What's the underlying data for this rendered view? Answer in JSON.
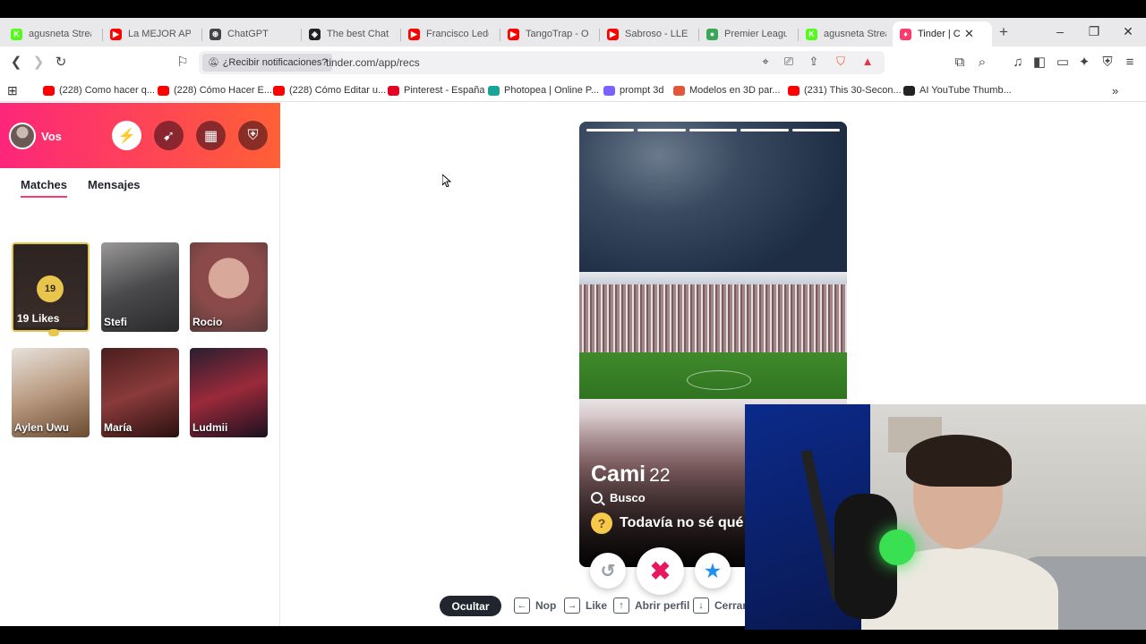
{
  "tabs": [
    {
      "title": "agusneta Stream",
      "color": "#53fc18",
      "glyph": "K"
    },
    {
      "title": "La MEJOR APER",
      "color": "#ff0000",
      "glyph": "▶"
    },
    {
      "title": "ChatGPT",
      "color": "#444444",
      "glyph": "⊛"
    },
    {
      "title": "The best ChatB",
      "color": "#222222",
      "glyph": "◈"
    },
    {
      "title": "Francisco Lede",
      "color": "#ff0000",
      "glyph": "▶"
    },
    {
      "title": "TangoTrap - Os",
      "color": "#ff0000",
      "glyph": "▶"
    },
    {
      "title": "Sabroso - LLEG",
      "color": "#ff0000",
      "glyph": "▶"
    },
    {
      "title": "Premier League",
      "color": "#3aa757",
      "glyph": "●"
    },
    {
      "title": "agusneta Strea",
      "color": "#53fc18",
      "glyph": "K"
    },
    {
      "title": "Tinder | Co",
      "color": "#fd3a6e",
      "glyph": "♦",
      "active": true
    }
  ],
  "address": {
    "notif_chip": "¿Recibir notificaciones?",
    "url": "tinder.com/app/recs"
  },
  "bookmarks": [
    {
      "label": "(228) Como hacer q...",
      "color": "#ff0000"
    },
    {
      "label": "(228) Cómo Hacer E...",
      "color": "#ff0000"
    },
    {
      "label": "(228) Cómo Editar u...",
      "color": "#ff0000"
    },
    {
      "label": "Pinterest - España",
      "color": "#e60023"
    },
    {
      "label": "Photopea | Online P...",
      "color": "#18a497"
    },
    {
      "label": "prompt 3d",
      "color": "#7b61ff"
    },
    {
      "label": "Modelos en 3D par...",
      "color": "#e2563a"
    },
    {
      "label": "(231) This 30-Secon...",
      "color": "#ff0000"
    },
    {
      "label": "AI YouTube Thumb...",
      "color": "#222222"
    }
  ],
  "sidebar": {
    "profile_label": "Vos",
    "tab_matches": "Matches",
    "tab_messages": "Mensajes",
    "likes_count": "19",
    "likes_label": "19 Likes",
    "matches": [
      {
        "name": "Stefi",
        "bg": "linear-gradient(160deg,#9a9898,#4a4a4c 50%,#2a2a2c)"
      },
      {
        "name": "Rocio",
        "bg": "radial-gradient(circle at 50% 40%,#d8a89a 0 30%,#8a4a4a 31% 50%,#5a3a3a 100%)"
      },
      {
        "name": "Aylen Uwu",
        "bg": "linear-gradient(160deg,#e8e2dc,#b89a80 50%,#6a4a30)"
      },
      {
        "name": "María",
        "bg": "linear-gradient(160deg,#4a1e1e,#8a3a3a 50%,#2a1010)"
      },
      {
        "name": "Ludmii",
        "bg": "linear-gradient(160deg,#2a1e30,#9a2a3a 50%,#1a1020)"
      }
    ]
  },
  "profile": {
    "name": "Cami",
    "age": "22",
    "looking_label": "Busco",
    "looking_value": "Todavía no sé qué",
    "story_total": 5,
    "story_active": 5
  },
  "hints": {
    "hide": "Ocultar",
    "nope": "Nop",
    "like": "Like",
    "open": "Abrir perfil",
    "close": "Cerrar"
  },
  "colors": {
    "brand_start": "#fd267a",
    "brand_end": "#ff6036",
    "nope": "#e9175f",
    "superlike": "#1f8ff0",
    "gold": "#e8c54c"
  }
}
